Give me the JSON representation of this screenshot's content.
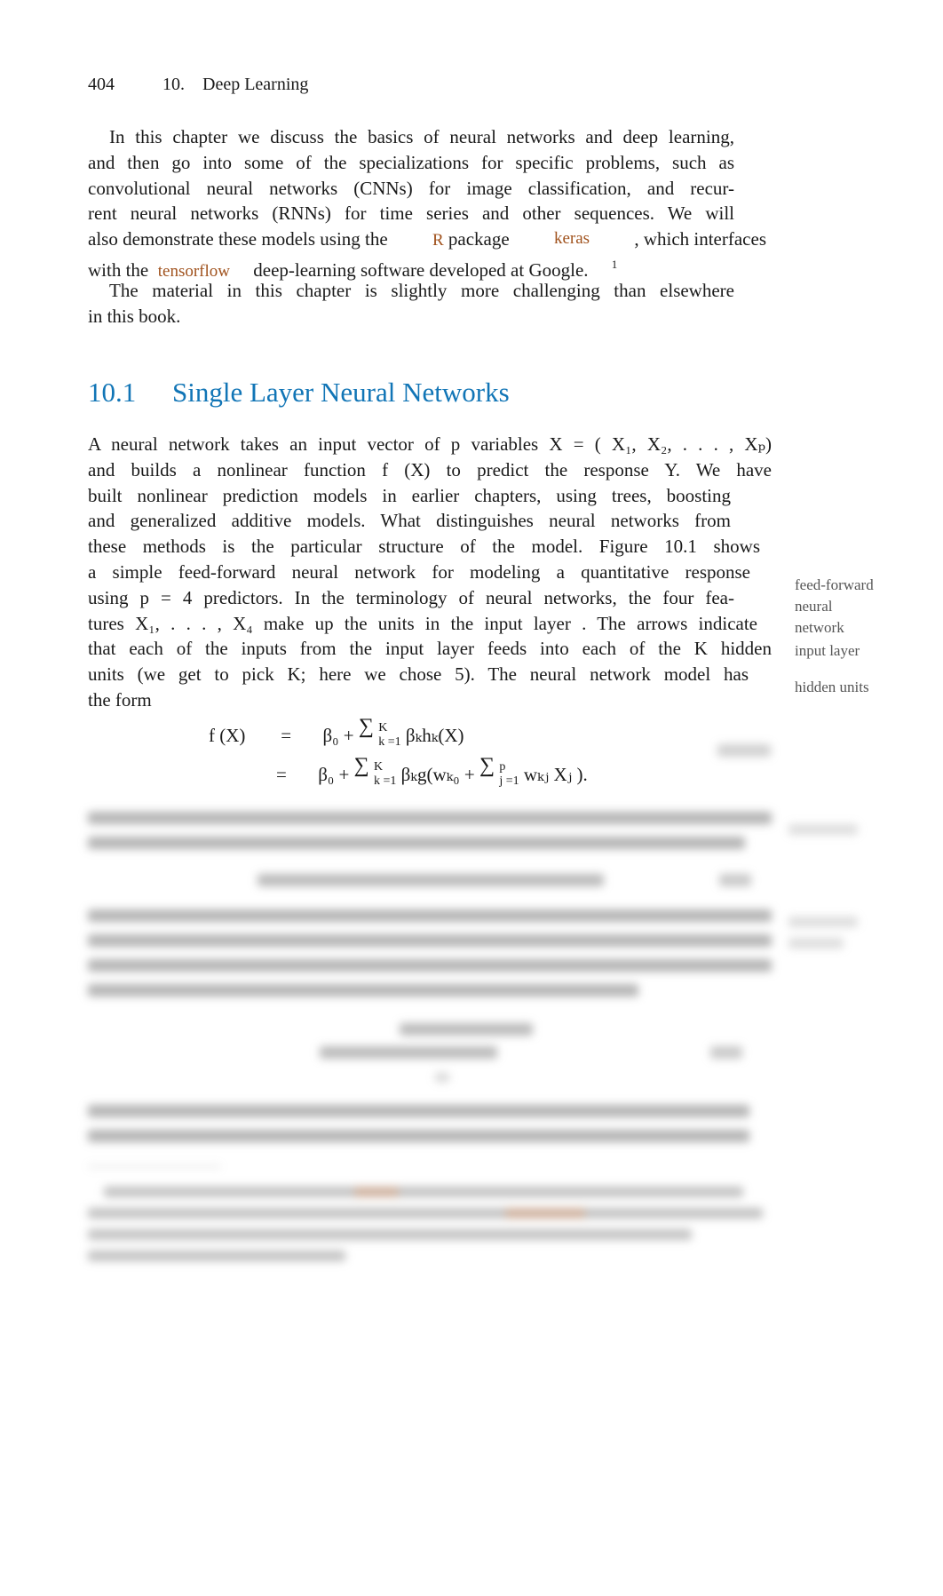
{
  "header": {
    "page_number": "404",
    "chapter_number": "10.",
    "chapter_title": "Deep Learning"
  },
  "intro": {
    "p1_lines": [
      "In this chapter we discuss the basics of neural networks and deep learning,",
      "and then go into some of the specializations for specific problems, such as",
      "convolutional neural networks (CNNs) for image classification, and recur-",
      "rent neural networks (RNNs) for time series and other sequences. We will"
    ],
    "p1_line5_a": "also demonstrate these models using the",
    "p1_line5_code_r": "R",
    "p1_line5_b": "package",
    "p1_line5_code_keras": "keras",
    "p1_line5_c": ", which interfaces",
    "p1_line6_a": "with the",
    "p1_line6_code_tf": "tensorflow",
    "p1_line6_b": "deep-learning software developed at Google.",
    "footnote_marker": "1",
    "p2_lines": [
      "The material in this chapter is slightly more challenging than elsewhere",
      "in this book."
    ]
  },
  "section": {
    "number": "10.1",
    "title": "Single Layer Neural Networks"
  },
  "body": {
    "lines": [
      "A neural network takes an input vector of  p variables  X = ( X₁, X₂, . . . , Xₚ)",
      "and builds a nonlinear function  f (X) to predict the response  Y. We have",
      "built nonlinear prediction models in earlier chapters, using trees, boosting",
      "and generalized additive models. What distinguishes neural networks from",
      "these methods is the particular  structure  of the model. Figure 10.1 shows",
      "a simple  feed-forward neural network  for modeling a quantitative response",
      "using p = 4 predictors. In the terminology of neural networks, the four fea-",
      "tures  X₁, . . . , X₄ make up the units in the  input layer . The arrows indicate",
      "that each of the inputs from the input layer feeds into each of the  K hidden",
      "units  (we get to pick  K; here we chose 5). The neural network model has",
      "the form"
    ]
  },
  "equation": {
    "lhs": "f (X)",
    "eq": "=",
    "line1_a": "β₀ +",
    "sum": "∑",
    "upper_k": "K",
    "lower_k": "k =1",
    "line1_b": "βₖhₖ(X)",
    "line2_a": "β₀ +",
    "line2_b": "βₖg(wₖ₀ +",
    "upper_p": "p",
    "lower_j": "j =1",
    "line2_c": "wₖⱼ Xⱼ )."
  },
  "margin_notes": {
    "feed_forward": [
      "feed-forward",
      "neural",
      "network"
    ],
    "input_layer": "input layer",
    "hidden_units": "hidden units"
  },
  "colors": {
    "section_title": "#1175b6",
    "code": "#a0521d",
    "margin_note": "#555555",
    "text": "#1a1a1a"
  }
}
